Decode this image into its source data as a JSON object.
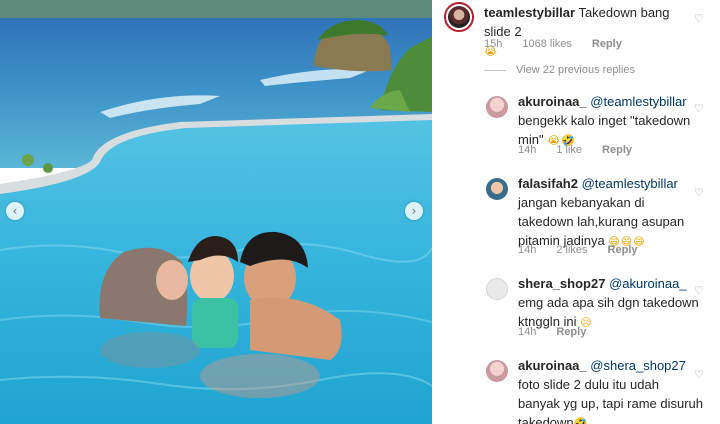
{
  "post": {
    "prev_icon": "chevron-left-icon",
    "next_icon": "chevron-right-icon",
    "prev_glyph": "‹",
    "next_glyph": "›"
  },
  "comments": [
    {
      "username": "teamlestybillar",
      "text": "Takedown bang slide 2",
      "emoji": "😭",
      "time": "15h",
      "likes": "1068 likes",
      "reply_label": "Reply"
    },
    {
      "username": "akuroinaa_",
      "mention": "@teamlestybillar",
      "text_line1": "bengekk kalo inget \"takedown",
      "text_line2": "min\"",
      "emoji": "😭🤣",
      "time": "14h",
      "likes": "1 like",
      "reply_label": "Reply"
    },
    {
      "username": "falasifah2",
      "mention": "@teamlestybillar",
      "text_line1": "jangan kebanyakan di",
      "text_line2": "takedown lah,kurang asupan",
      "text_line3": "pitamin jadinya",
      "emoji": "😄😄😄",
      "time": "14h",
      "likes": "2 likes",
      "reply_label": "Reply"
    },
    {
      "username": "shera_shop27",
      "mention": "@akuroinaa_",
      "text_line1": "emg ada apa sih dgn takedown",
      "text_line2": "ktnggln ini",
      "emoji": "😥",
      "time": "14h",
      "reply_label": "Reply"
    },
    {
      "username": "akuroinaa_",
      "mention": "@shera_shop27",
      "text_line1": "foto slide 2 dulu itu udah",
      "text_line2": "banyak yg up, tapi rame disuruh",
      "text_line3": "takedown",
      "emoji": "🤣"
    }
  ],
  "view_replies_label": "View 22 previous replies",
  "heart_icon": "heart-outline-icon",
  "heart_glyph": "♡"
}
